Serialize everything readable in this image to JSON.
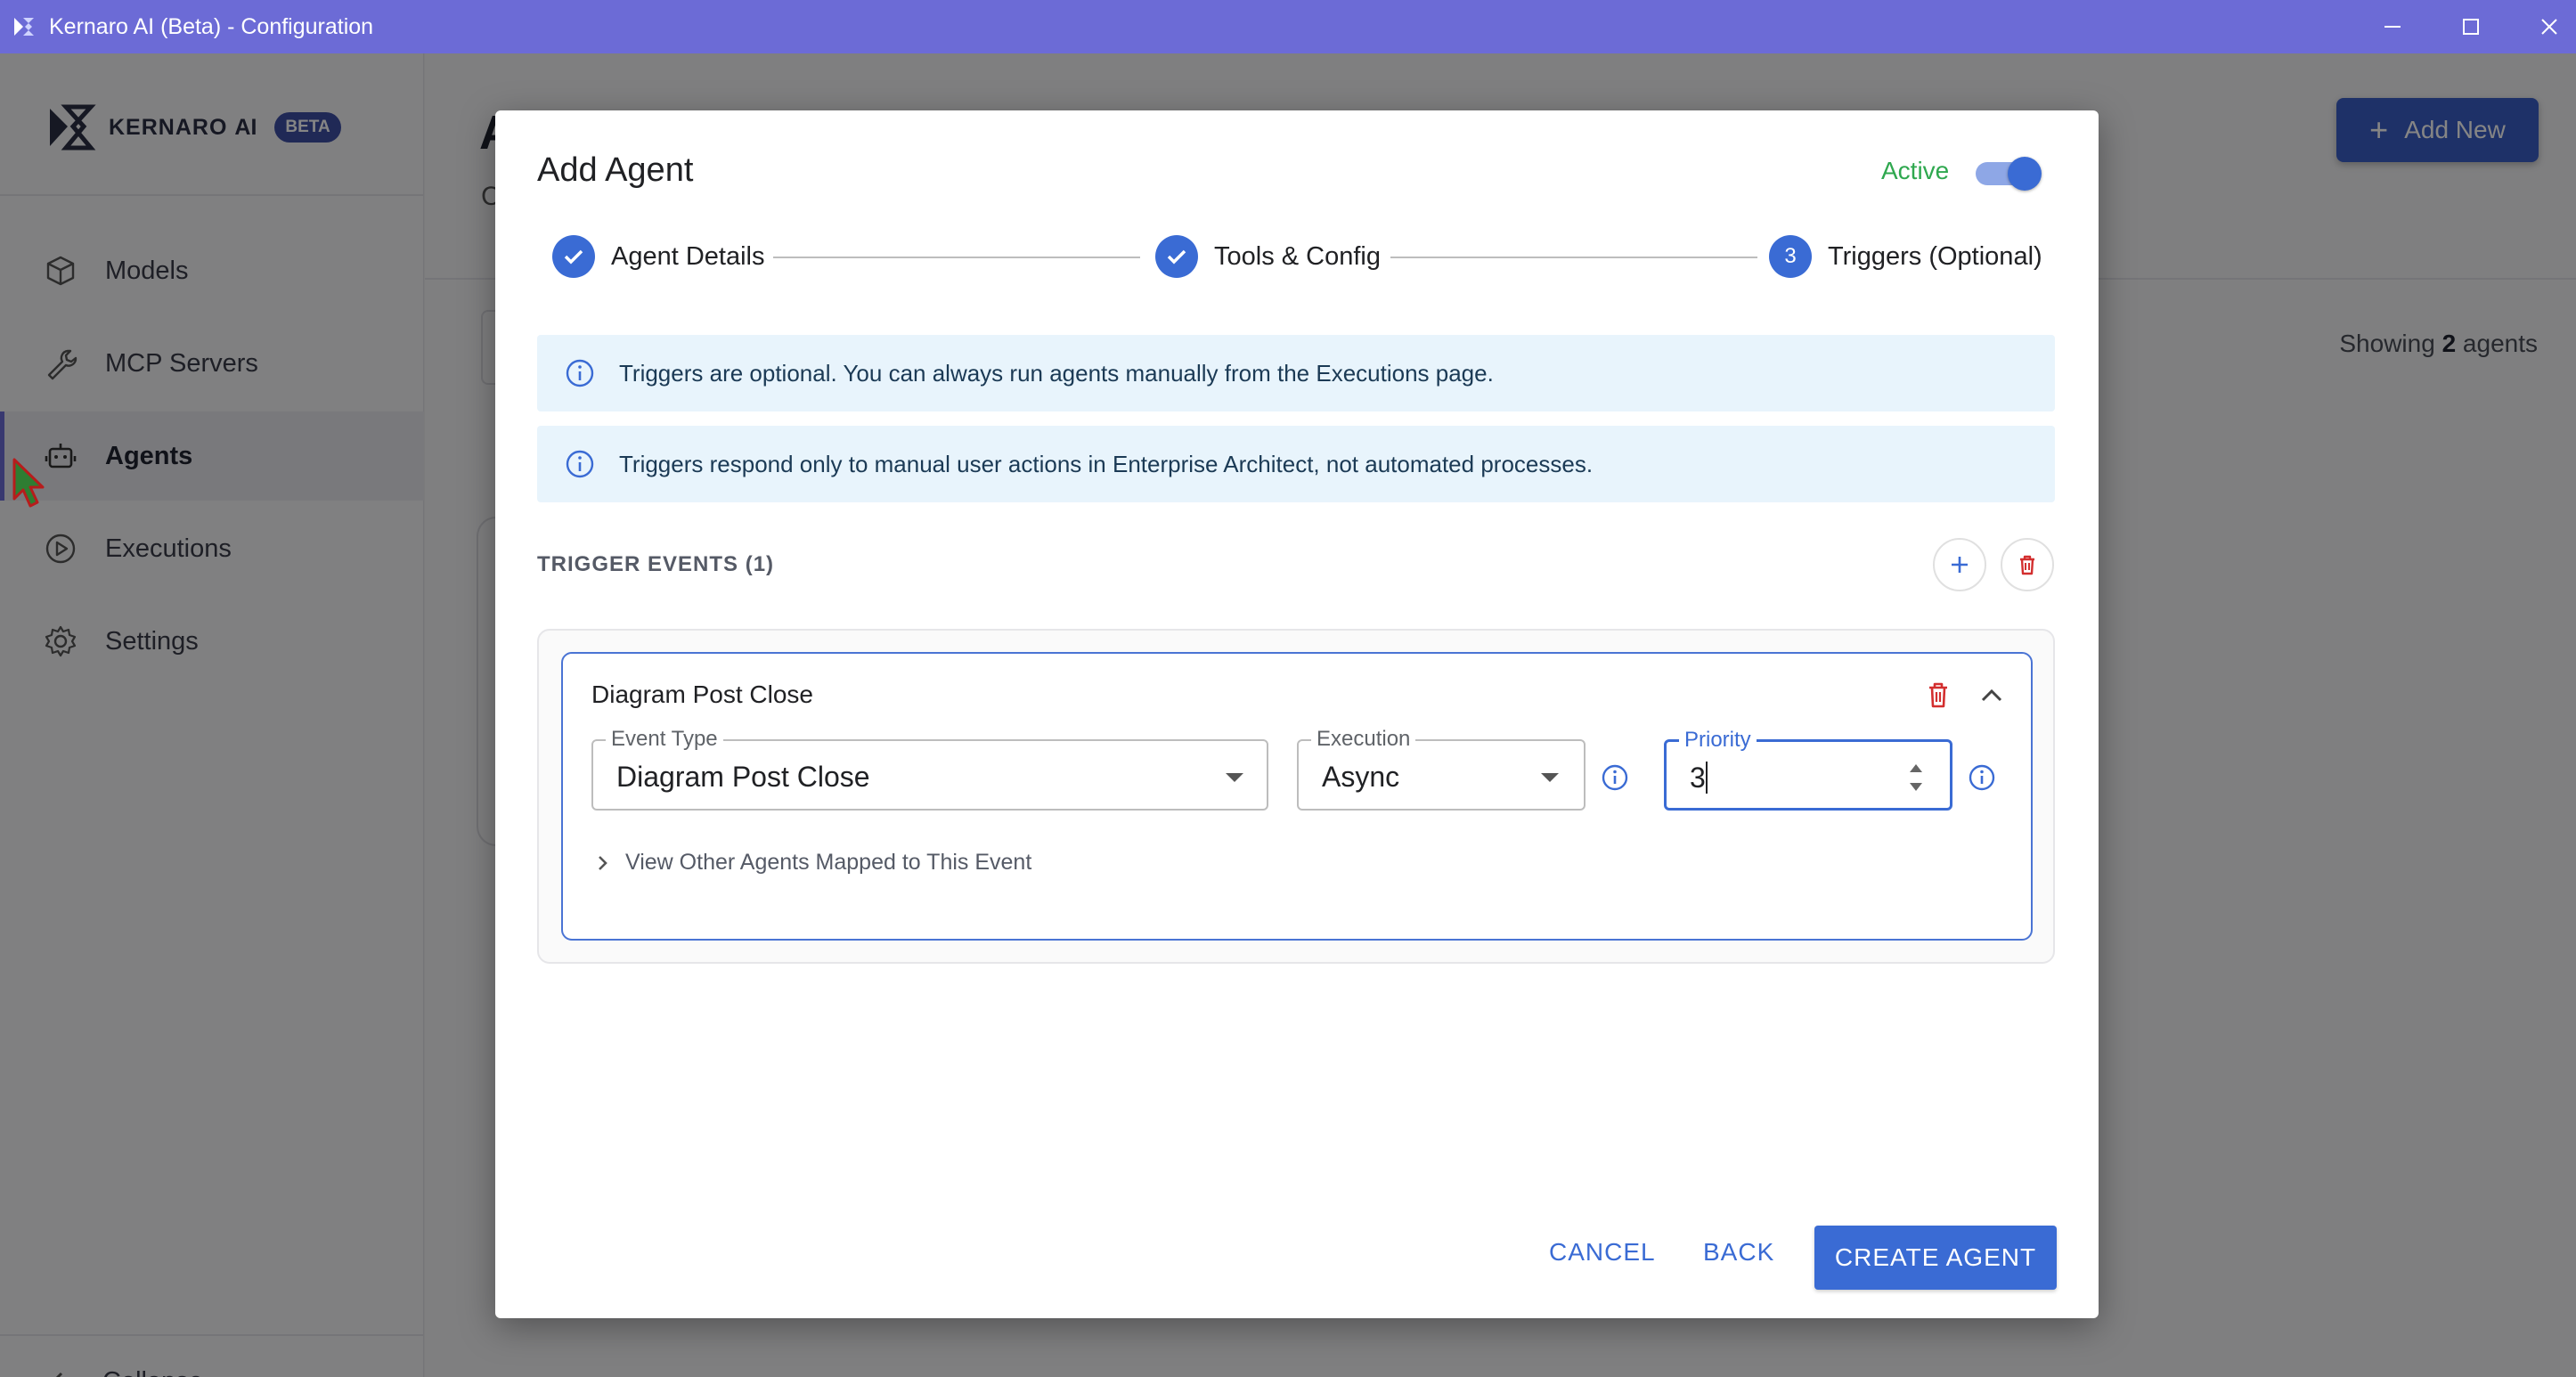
{
  "window": {
    "title": "Kernaro AI (Beta) - Configuration"
  },
  "sidebar": {
    "logo_text": "KERNARO",
    "logo_ai": "AI",
    "beta_badge": "BETA",
    "items": [
      {
        "label": "Models",
        "icon": "cube-icon"
      },
      {
        "label": "MCP Servers",
        "icon": "wrench-icon"
      },
      {
        "label": "Agents",
        "icon": "robot-icon",
        "active": true
      },
      {
        "label": "Executions",
        "icon": "play-circle-icon"
      },
      {
        "label": "Settings",
        "icon": "gear-icon"
      }
    ],
    "collapse_label": "Collapse"
  },
  "main": {
    "title_fragment": "A",
    "subtitle_fragment": "C",
    "add_new_label": "Add New",
    "showing_prefix": "Showing",
    "showing_count": "2",
    "showing_suffix": "agents"
  },
  "modal": {
    "title": "Add Agent",
    "active_label": "Active",
    "active_on": true,
    "steps": [
      {
        "label": "Agent Details",
        "state": "done"
      },
      {
        "label": "Tools & Config",
        "state": "done"
      },
      {
        "label": "Triggers (Optional)",
        "state": "current",
        "number": "3"
      }
    ],
    "info_1": "Triggers are optional. You can always run agents manually from the Executions page.",
    "info_2": "Triggers respond only to manual user actions in Enterprise Architect, not automated processes.",
    "section_label": "TRIGGER EVENTS (1)",
    "trigger": {
      "title": "Diagram Post Close",
      "event_type_label": "Event Type",
      "event_type_value": "Diagram Post Close",
      "execution_label": "Execution",
      "execution_value": "Async",
      "priority_label": "Priority",
      "priority_value": "3",
      "view_other": "View Other Agents Mapped to This Event"
    },
    "cancel_label": "CANCEL",
    "back_label": "BACK",
    "create_label": "CREATE AGENT"
  },
  "colors": {
    "titlebar": "#6c6bd6",
    "primary": "#3a6bd4",
    "active_green": "#2fa84f",
    "danger": "#d32f2f",
    "info_bg": "#e8f4fc"
  }
}
